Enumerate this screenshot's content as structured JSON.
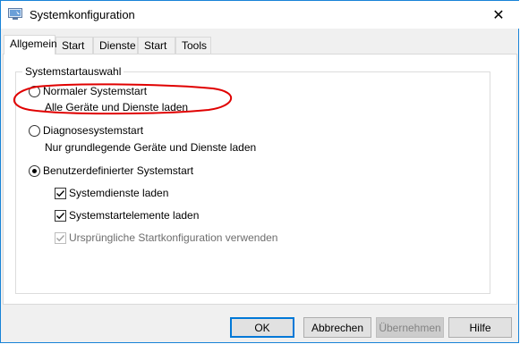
{
  "window": {
    "title": "Systemkonfiguration",
    "close_glyph": "✕"
  },
  "tabs": [
    {
      "label": "Allgemein",
      "active": true
    },
    {
      "label": "Start",
      "active": false
    },
    {
      "label": "Dienste",
      "active": false
    },
    {
      "label": "Start",
      "active": false
    },
    {
      "label": "Tools",
      "active": false
    }
  ],
  "group": {
    "legend": "Systemstartauswahl",
    "options": [
      {
        "label": "Normaler Systemstart",
        "description": "Alle Geräte und Dienste laden",
        "selected": false
      },
      {
        "label": "Diagnosesystemstart",
        "description": "Nur grundlegende Geräte und Dienste laden",
        "selected": false
      },
      {
        "label": "Benutzerdefinierter Systemstart",
        "selected": true
      }
    ],
    "checkboxes": [
      {
        "label": "Systemdienste laden",
        "checked": true,
        "enabled": true
      },
      {
        "label": "Systemstartelemente laden",
        "checked": true,
        "enabled": true
      },
      {
        "label": "Ursprüngliche Startkonfiguration verwenden",
        "checked": true,
        "enabled": false
      }
    ]
  },
  "buttons": {
    "ok": "OK",
    "cancel": "Abbrechen",
    "apply": "Übernehmen",
    "help": "Hilfe"
  },
  "colors": {
    "window_border": "#1883d7",
    "annotation": "#e00000",
    "default_button_border": "#0078d7"
  }
}
